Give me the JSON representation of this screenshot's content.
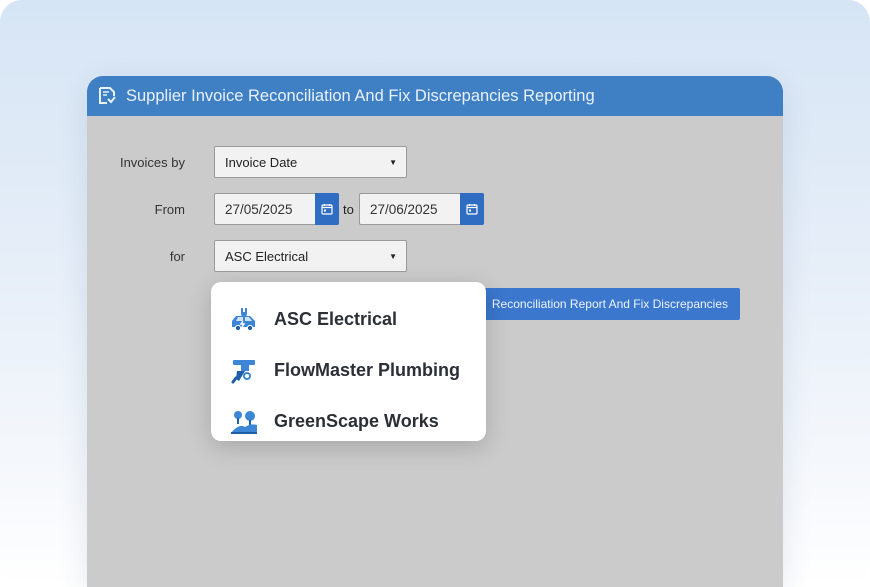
{
  "window": {
    "title": "Supplier Invoice Reconciliation And Fix Discrepancies Reporting",
    "title_icon": "report-export-icon"
  },
  "form": {
    "invoices_by": {
      "label": "Invoices by",
      "value": "Invoice Date"
    },
    "from": {
      "label": "From",
      "start": "27/05/2025",
      "to_label": "to",
      "end": "27/06/2025"
    },
    "for": {
      "label": "for",
      "value": "ASC Electrical"
    }
  },
  "report_button": {
    "label": "Reconciliation Report And Fix Discrepancies"
  },
  "dropdown": {
    "items": [
      {
        "label": "ASC Electrical",
        "icon": "electric-van-icon"
      },
      {
        "label": "FlowMaster Plumbing",
        "icon": "plumbing-wrench-icon"
      },
      {
        "label": "GreenScape Works",
        "icon": "landscaping-trees-icon"
      }
    ]
  },
  "colors": {
    "accent": "#3f7fc3",
    "button": "#3a77cd",
    "panel": "#cbcbcb"
  }
}
